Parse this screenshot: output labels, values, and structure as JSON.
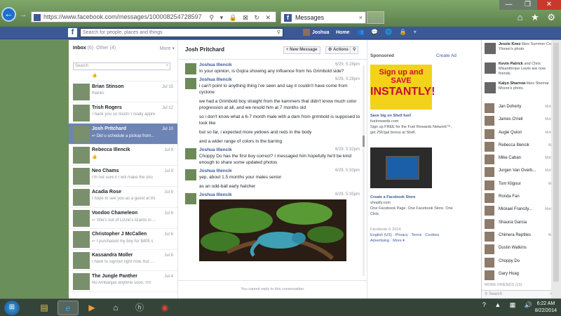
{
  "browser": {
    "url": "https://www.facebook.com/messages/100008254728597",
    "tab_title": "Messages",
    "tab_close": "×",
    "win_buttons": [
      "—",
      "❐",
      "✕"
    ],
    "tool_icons": "⌂ ★ ⚙",
    "back": "←",
    "forward": "→",
    "url_icons": "⚲ ▾ 🔒 ⊠ ↻ ✕"
  },
  "fb_header": {
    "search_placeholder": "Search for people, places and things",
    "user_name": "Joshua",
    "home": "Home",
    "icons": "👥 💬 🌐 🔒 ▾"
  },
  "inbox": {
    "label": "Inbox",
    "count": "(6)",
    "other": "Other (4)",
    "more": "More ▾",
    "search_placeholder": "Search",
    "search_clear": "×",
    "threads": [
      {
        "name": "Michael Richards",
        "snippet": "👍",
        "date": "Jul 15",
        "partial": true
      },
      {
        "name": "Brian Stinson",
        "snippet": "thanks",
        "date": "Jul 15"
      },
      {
        "name": "Trish Rogers",
        "snippet": "Thank you so much! I really appre",
        "date": "Jul 12"
      },
      {
        "name": "Josh Pritchard",
        "snippet": "↩ Did u schedule a pickup from...",
        "date": "Jul 10",
        "selected": true
      },
      {
        "name": "Rebecca Illencik",
        "snippet": "👍",
        "date": "Jul 9"
      },
      {
        "name": "Neo Chams",
        "snippet": "I'm not sure if I will make the sho",
        "date": "Jul 9"
      },
      {
        "name": "Acadia Rose",
        "snippet": "I hope to see you as a guest at thi",
        "date": "Jul 8"
      },
      {
        "name": "Voodoo Chameleon",
        "snippet": "↩ She's out of Lizzie's lizards in ...",
        "date": "Jul 6"
      },
      {
        "name": "Christopher J McCallen",
        "snippet": "↩ I purchased my boy for $405 s",
        "date": "Jul 6"
      },
      {
        "name": "Kassandra Moller",
        "snippet": "I have to signout right now, but ...",
        "date": "Jul 6"
      },
      {
        "name": "The Jungle Panther",
        "snippet": "No Ambanjas anytime soon. I'm",
        "date": "Jul 4"
      }
    ]
  },
  "conversation": {
    "title": "Josh Pritchard",
    "new_message": "+ New Message",
    "actions": "⚙ Actions",
    "search_icon": "⚲",
    "messages": [
      {
        "sender": "Joshua Illencik",
        "time": "6/29, 5:28pm",
        "lines": [
          "In your opinion, is Gojira showing any influence from his Grimbold side?"
        ]
      },
      {
        "sender": "Joshua Illencik",
        "time": "6/29, 5:28pm",
        "lines": [
          "i can't point to anything thing i've seen and say it couldn't have come from cyclone",
          "we had a Grimbold boy straight from the kammers that didn't know much color progression at all, and we resold him at 7 months old",
          "so i don't know what a 6-7 month male with a dam from grimbold is supposed to look like",
          "but so far, i expected more yellows and reds in the body",
          "and a wider range of colors in the barring"
        ]
      },
      {
        "sender": "Joshua Illencik",
        "time": "6/29, 5:32pm",
        "lines": [
          "Choppy Do has the first boy correct?  I messaged him hopefully he'll be kind enough to share some updated photos"
        ]
      },
      {
        "sender": "Joshua Illencik",
        "time": "6/29, 5:33pm",
        "lines": [
          "yep, about 1.5 months your males senior",
          "as an odd-ball early hatcher"
        ]
      },
      {
        "sender": "Joshua Illencik",
        "time": "6/29, 5:35pm",
        "lines": []
      }
    ],
    "footer": "You cannot reply to this conversation."
  },
  "ads": {
    "sponsored": "Sponsored",
    "create_ad": "Create Ad",
    "ad1_line1": "Sign up and SAVE",
    "ad1_line2": "INSTANTLY!",
    "ad1_title": "Save big on Shell fuel!",
    "ad1_domain": "fuelrewards.com",
    "ad1_body": "Sign up FREE for the Fuel Rewards Network™, get 25¢/gal bonus at Shell.",
    "ad2_title": "Create a Facebook Store",
    "ad2_domain": "shopify.com",
    "ad2_body": "One Facebook Page. One Facebook Store. One Click.",
    "footer_copy": "Facebook © 2014",
    "footer_links": "English (US) · Privacy · Terms · Cookies",
    "footer_links2": "Advertising · More ▾"
  },
  "chat": {
    "ticker": [
      {
        "name": "Jessie Knez",
        "text": "likes Summer Collins Ylonen's photo."
      },
      {
        "name": "Kevin Patrick",
        "text": "and Chris Misanthrope Lewis are now friends."
      },
      {
        "name": "Kalyn Sharrow",
        "text": "likes Shemar Moore's photo."
      }
    ],
    "buddies": [
      {
        "name": "Jan Doherty",
        "status": "Mobile",
        "online": true
      },
      {
        "name": "James O'neil",
        "status": "Mobile",
        "online": true
      },
      {
        "name": "Augie Quion",
        "status": "Mobile",
        "online": true
      },
      {
        "name": "Rebecca Illencik",
        "status": "Web",
        "online": true
      },
      {
        "name": "Mike Caban",
        "status": "Mobile",
        "online": true
      },
      {
        "name": "Jurgen Van Overb...",
        "status": "Mobile",
        "online": true
      },
      {
        "name": "Tom Kilgour",
        "status": "Web",
        "online": true
      },
      {
        "name": "Ronda Fan",
        "status": "7h",
        "online": false
      },
      {
        "name": "Mickael Francity...",
        "status": "Mobile",
        "online": true
      },
      {
        "name": "Shauna Garcia",
        "status": "4h",
        "online": false
      },
      {
        "name": "Chimera Reptiles",
        "status": "Web",
        "online": true
      },
      {
        "name": "Dustin Watkins",
        "status": "",
        "online": false
      },
      {
        "name": "Choppy Do",
        "status": "7h",
        "online": false
      },
      {
        "name": "Gary Hoag",
        "status": "9h",
        "online": false
      }
    ],
    "more_friends": "MORE FRIENDS (15)",
    "search": "⚲ Search",
    "gear": "⚙ ▭"
  },
  "taskbar": {
    "start": "⊞",
    "tray": "? ▲ ▦ 🔊",
    "time": "6:22 AM",
    "date": "8/22/2014"
  }
}
